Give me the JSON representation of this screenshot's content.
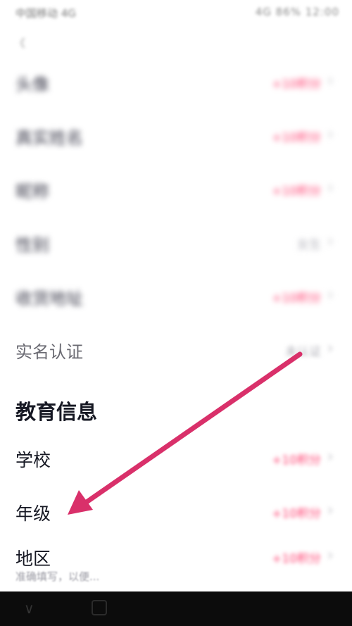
{
  "status_bar": {
    "carrier": "中国移动 4G",
    "indicators": "4G 86% 12:00"
  },
  "back_hint": "《",
  "profile_rows": [
    {
      "label": "头像",
      "value": "+10积分",
      "muted": false
    },
    {
      "label": "真实姓名",
      "value": "+10积分",
      "muted": false
    },
    {
      "label": "昵称",
      "value": "+10积分",
      "muted": false
    },
    {
      "label": "性别",
      "value": "女生",
      "muted": true
    },
    {
      "label": "收货地址",
      "value": "+10积分",
      "muted": false
    },
    {
      "label": "实名认证",
      "value": "未认证",
      "muted": true
    }
  ],
  "education": {
    "title": "教育信息",
    "rows": [
      {
        "label": "学校",
        "value": "+10积分"
      },
      {
        "label": "年级",
        "value": "+10积分"
      },
      {
        "label": "地区",
        "value": "+10积分"
      }
    ],
    "hint": "准确填写，以便..."
  },
  "chevron": "›",
  "navbar": {
    "back_symbol": "∨"
  },
  "colors": {
    "accent": "#ff3d6e",
    "arrow": "#d9306a"
  }
}
